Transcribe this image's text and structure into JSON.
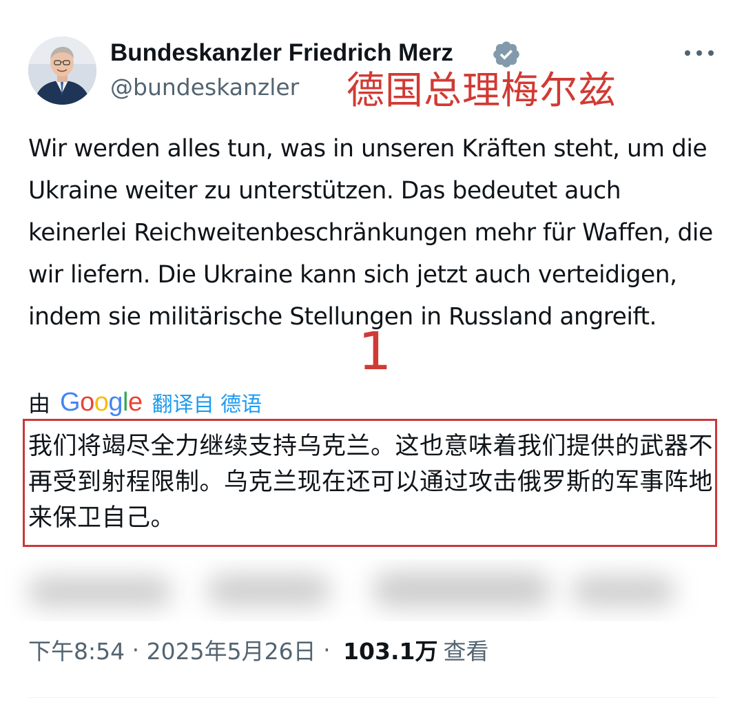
{
  "tweet": {
    "display_name": "Bundeskanzler Friedrich Merz",
    "handle": "@bundeskanzler",
    "annotation_name": "德国总理梅尔兹",
    "text": "Wir werden alles tun, was in unseren Kräften steht, um die Ukraine weiter zu unterstützen. Das bedeutet auch keinerlei Reichweitenbeschränkungen mehr für Waffen, die wir liefern. Die Ukraine kann sich jetzt auch verteidigen, indem sie militärische Stellungen in Russland angreift.",
    "annotation_marker": "1",
    "translate": {
      "by": "由",
      "provider": "Google",
      "link": "翻译自 德语"
    },
    "translation": "我们将竭尽全力继续支持乌克兰。这也意味着我们提供的武器不再受到射程限制。乌克兰现在还可以通过攻击俄罗斯的军事阵地来保卫自己。",
    "meta": {
      "time": "下午8:54",
      "date": "2025年5月26日",
      "views_count": "103.1万",
      "views_label": "查看"
    }
  },
  "icons": {
    "verified": "verified-badge-icon",
    "more": "more-options-icon"
  },
  "colors": {
    "annotation_red": "#d13a34",
    "link_blue": "#1d9bf0",
    "secondary_text": "#536471",
    "verified_gray": "#829aab"
  }
}
